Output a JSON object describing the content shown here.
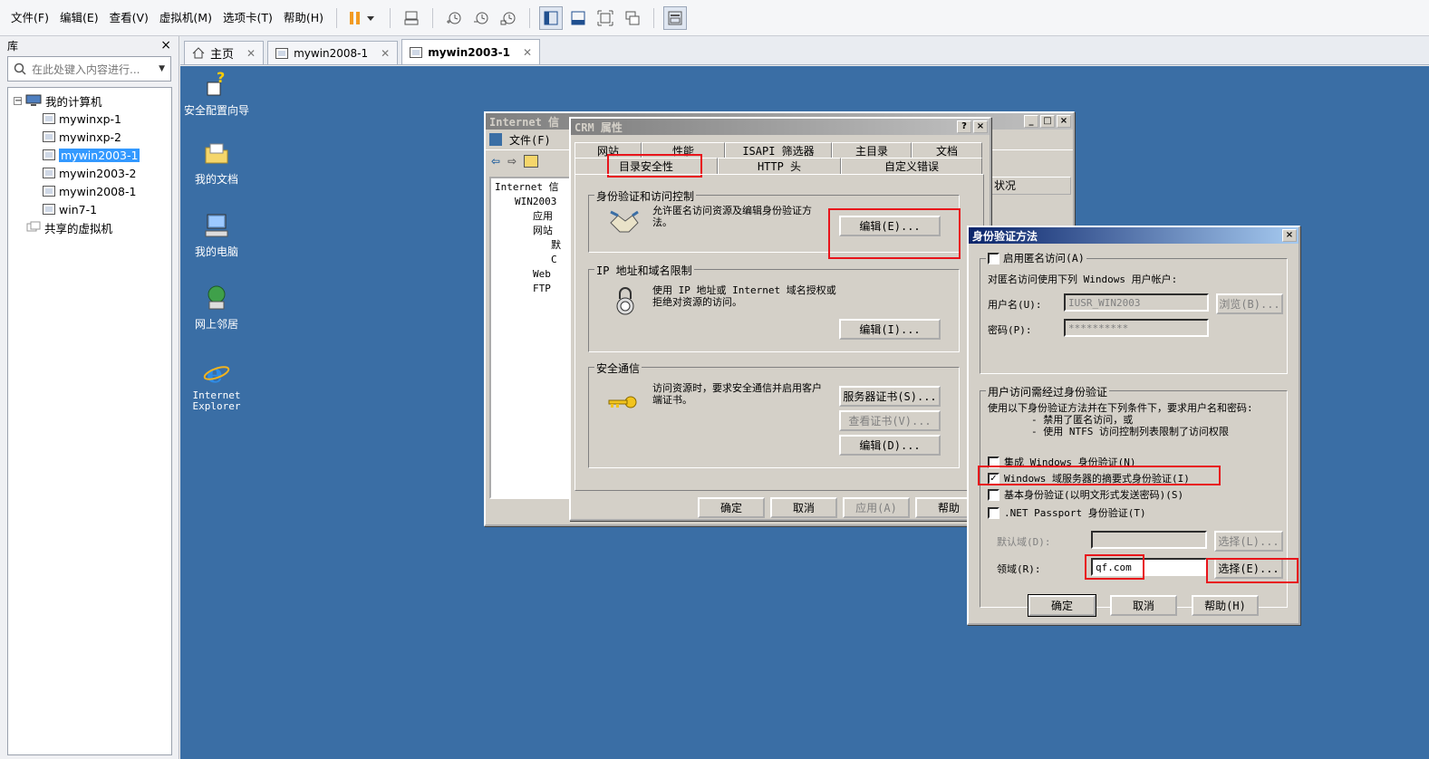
{
  "menubar": {
    "items": [
      "文件(F)",
      "编辑(E)",
      "查看(V)",
      "虚拟机(M)",
      "选项卡(T)",
      "帮助(H)"
    ]
  },
  "library": {
    "title": "库",
    "close": "×",
    "search_placeholder": "在此处键入内容进行...",
    "tree": {
      "root": "我的计算机",
      "items": [
        "mywinxp-1",
        "mywinxp-2",
        "mywin2003-1",
        "mywin2003-2",
        "mywin2008-1",
        "win7-1"
      ],
      "selected": "mywin2003-1",
      "shared": "共享的虚拟机"
    }
  },
  "tabs": [
    {
      "label": "主页",
      "active": false
    },
    {
      "label": "mywin2008-1",
      "active": false
    },
    {
      "label": "mywin2003-1",
      "active": true
    }
  ],
  "desktop": {
    "icons": [
      "安全配置向导",
      "我的文档",
      "我的电脑",
      "网上邻居",
      "Internet Explorer"
    ]
  },
  "iis_window": {
    "title": "Internet 信",
    "menu_file": "文件(F)",
    "tree": [
      "Internet 信",
      "WIN2003",
      "应用",
      "网站",
      "默",
      "C",
      "Web",
      "FTP"
    ],
    "status_col": "状况"
  },
  "crm_dialog": {
    "title": "CRM 属性",
    "tabs_row1": [
      "网站",
      "性能",
      "ISAPI 筛选器",
      "主目录",
      "文档"
    ],
    "tabs_row2": [
      "目录安全性",
      "HTTP 头",
      "自定义错误"
    ],
    "auth_group": {
      "title": "身份验证和访问控制",
      "text": "允许匿名访问资源及编辑身份验证方法。",
      "button": "编辑(E)..."
    },
    "ip_group": {
      "title": "IP 地址和域名限制",
      "text": "使用 IP 地址或 Internet 域名授权或拒绝对资源的访问。",
      "button": "编辑(I)..."
    },
    "secure_group": {
      "title": "安全通信",
      "text": "访问资源时，要求安全通信并启用客户端证书。",
      "btn_cert": "服务器证书(S)...",
      "btn_view": "查看证书(V)...",
      "btn_edit": "编辑(D)..."
    },
    "footer": {
      "ok": "确定",
      "cancel": "取消",
      "apply": "应用(A)",
      "help": "帮助"
    }
  },
  "auth_dialog": {
    "title": "身份验证方法",
    "anon_checkbox": "启用匿名访问(A)",
    "anon_desc": "对匿名访问使用下列 Windows 用户帐户:",
    "user_label": "用户名(U):",
    "user_value": "IUSR_WIN2003",
    "browse": "浏览(B)...",
    "pwd_label": "密码(P):",
    "pwd_value": "**********",
    "auth_group_title": "用户访问需经过身份验证",
    "auth_desc1": "使用以下身份验证方法并在下列条件下，要求用户名和密码:",
    "auth_desc2": "- 禁用了匿名访问，或",
    "auth_desc3": "- 使用 NTFS 访问控制列表限制了访问权限",
    "opt_integrated": "集成 Windows 身份验证(N)",
    "opt_digest": "Windows 域服务器的摘要式身份验证(I)",
    "opt_basic": "基本身份验证(以明文形式发送密码)(S)",
    "opt_passport": ".NET Passport 身份验证(T)",
    "default_domain_label": "默认域(D):",
    "select_disabled": "选择(L)...",
    "realm_label": "领域(R):",
    "realm_value": "qf.com",
    "select_realm": "选择(E)...",
    "ok": "确定",
    "cancel": "取消",
    "help": "帮助(H)"
  }
}
